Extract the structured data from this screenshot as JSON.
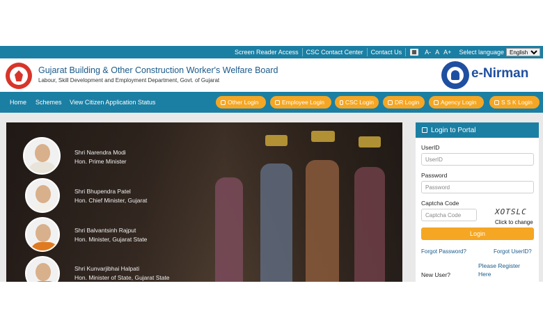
{
  "topbar": {
    "links": [
      "Screen Reader Access",
      "CSC Contact Center",
      "Contact Us"
    ],
    "font_sizes": [
      "A-",
      "A",
      "A+"
    ],
    "language_label": "Select language",
    "language_value": "English"
  },
  "header": {
    "title": "Gujarat Building & Other Construction Worker's Welfare Board",
    "subtitle": "Labour, Skill Development and Employment Department, Govt. of Gujarat",
    "brand": "e-Nirman"
  },
  "nav": {
    "links": [
      "Home",
      "Schemes",
      "View Citizen Application Status"
    ],
    "login_buttons": [
      "Other Login",
      "Employee Login",
      "CSC Login",
      "DR Login",
      "Agency Login",
      "S S K Login"
    ]
  },
  "banner": {
    "leaders": [
      {
        "name": "Shri Narendra Modi",
        "title": "Hon. Prime Minister"
      },
      {
        "name": "Shri Bhupendra Patel",
        "title": "Hon. Chief Minister, Gujarat"
      },
      {
        "name": "Shri Balvantsinh Rajput",
        "title": "Hon. Minister, Gujarat State"
      },
      {
        "name": "Shri Kunvarjibhai Halpati",
        "title": "Hon. Minister of State, Gujarat State"
      }
    ]
  },
  "login": {
    "heading": "Login to Portal",
    "userid_label": "UserID",
    "userid_placeholder": "UserID",
    "password_label": "Password",
    "password_placeholder": "Password",
    "captcha_label": "Captcha Code",
    "captcha_placeholder": "Captcha Code",
    "captcha_text": "XOTSLC",
    "captcha_change": "Click to change",
    "submit": "Login",
    "forgot_password": "Forgot Password?",
    "forgot_userid": "Forgot UserID?",
    "new_user": "New User?",
    "register": "Please Register Here"
  },
  "colors": {
    "bar_blue": "#1b7fa3",
    "accent_orange": "#f5a623",
    "brand_blue": "#1f4fa0",
    "seal_red": "#d8352a"
  }
}
